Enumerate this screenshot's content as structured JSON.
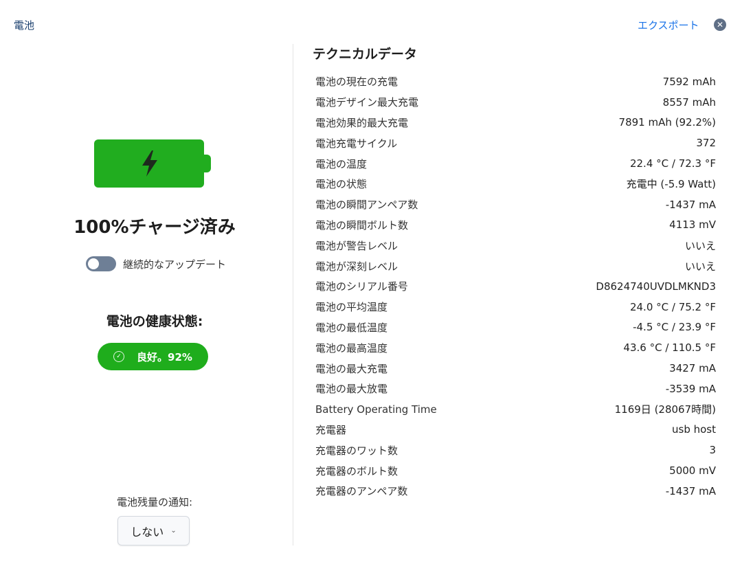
{
  "header": {
    "title": "電池",
    "export_label": "エクスポート",
    "close_icon": "close-icon"
  },
  "left": {
    "battery_icon": "battery-full-charging-icon",
    "battery_color": "#21ad1f",
    "charge_status": "100%チャージ済み",
    "continuous_update_label": "継続的なアップデート",
    "continuous_update_on": false,
    "health_title": "電池の健康状態:",
    "health_badge": "良好。92%",
    "health_color": "#1fad1c",
    "notify_label": "電池残量の通知:",
    "notify_value": "しない"
  },
  "technical": {
    "title": "テクニカルデータ",
    "rows": [
      {
        "label": "電池の現在の充電",
        "value": "7592 mAh"
      },
      {
        "label": "電池デザイン最大充電",
        "value": "8557 mAh"
      },
      {
        "label": "電池効果的最大充電",
        "value": "7891 mAh (92.2%)"
      },
      {
        "label": "電池充電サイクル",
        "value": "372"
      },
      {
        "label": "電池の温度",
        "value": "22.4 °C / 72.3 °F"
      },
      {
        "label": "電池の状態",
        "value": "充電中 (-5.9 Watt)"
      },
      {
        "label": "電池の瞬間アンペア数",
        "value": "-1437 mA"
      },
      {
        "label": "電池の瞬間ボルト数",
        "value": "4113 mV"
      },
      {
        "label": "電池が警告レベル",
        "value": "いいえ"
      },
      {
        "label": "電池が深刻レベル",
        "value": "いいえ"
      },
      {
        "label": "電池のシリアル番号",
        "value": "D8624740UVDLMKND3"
      },
      {
        "label": "電池の平均温度",
        "value": "24.0 °C / 75.2 °F"
      },
      {
        "label": "電池の最低温度",
        "value": "-4.5 °C / 23.9 °F"
      },
      {
        "label": "電池の最高温度",
        "value": "43.6 °C / 110.5 °F"
      },
      {
        "label": "電池の最大充電",
        "value": "3427 mA"
      },
      {
        "label": "電池の最大放電",
        "value": "-3539 mA"
      },
      {
        "label": "Battery Operating Time",
        "value": "1169日 (28067時間)"
      },
      {
        "label": "充電器",
        "value": "usb host"
      },
      {
        "label": "充電器のワット数",
        "value": "3"
      },
      {
        "label": "充電器のボルト数",
        "value": "5000 mV"
      },
      {
        "label": "充電器のアンペア数",
        "value": "-1437 mA"
      }
    ]
  }
}
